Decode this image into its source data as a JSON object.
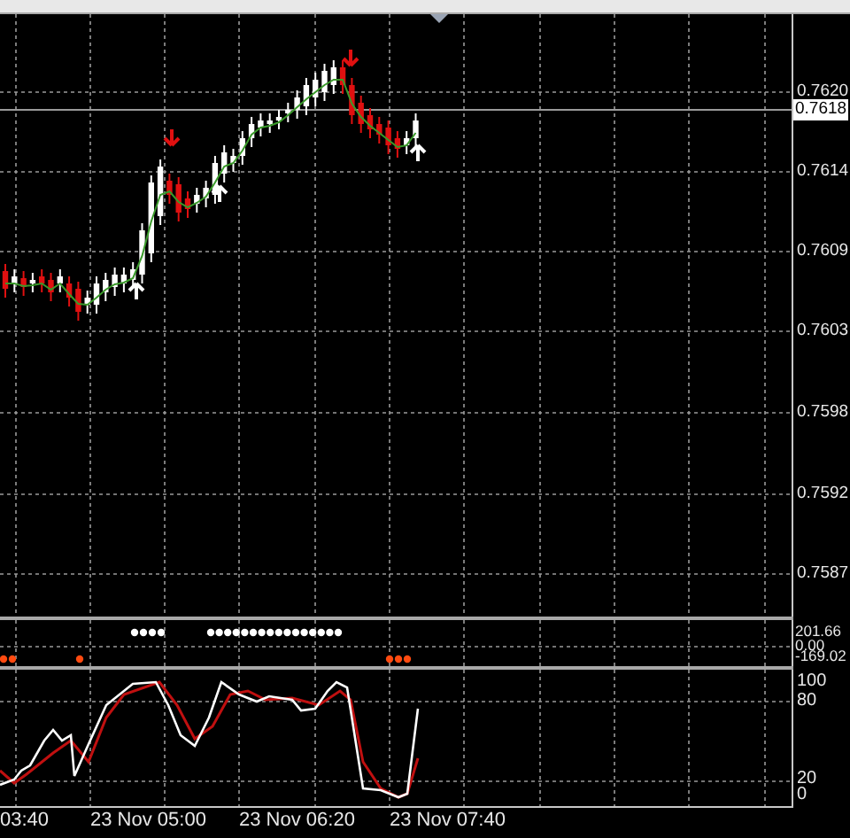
{
  "price_axis": [
    {
      "label": "0.7620",
      "kind": "tick"
    },
    {
      "label": "0.7618",
      "kind": "current"
    },
    {
      "label": "0.7614",
      "kind": "tick"
    },
    {
      "label": "0.7609",
      "kind": "tick"
    },
    {
      "label": "0.7603",
      "kind": "tick"
    },
    {
      "label": "0.7598",
      "kind": "tick"
    },
    {
      "label": "0.7592",
      "kind": "tick"
    },
    {
      "label": "0.7587",
      "kind": "tick"
    }
  ],
  "indicator_axis": [
    "201.66",
    "0.00",
    "-169.02"
  ],
  "oscillator_axis": [
    "100",
    "80",
    "20",
    "0"
  ],
  "time_axis": [
    "03:40",
    "23 Nov 05:00",
    "23 Nov 06:20",
    "23 Nov 07:40"
  ]
}
